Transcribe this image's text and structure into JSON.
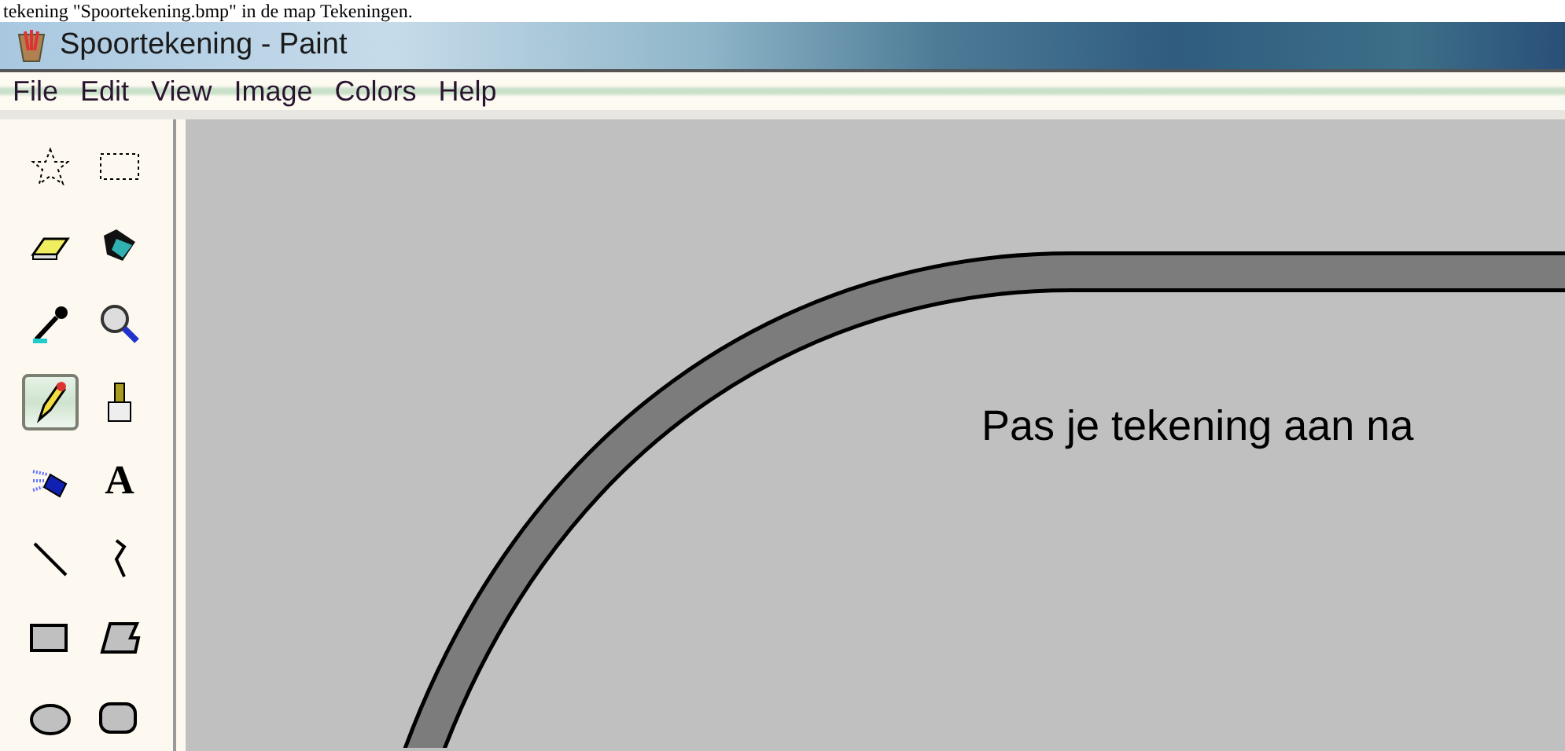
{
  "document_line": "tekening \"Spoortekening.bmp\" in de map Tekeningen.",
  "window": {
    "title": "Spoortekening - Paint"
  },
  "menu": [
    "File",
    "Edit",
    "View",
    "Image",
    "Colors",
    "Help"
  ],
  "tools": [
    {
      "kind": "free-select",
      "selected": false
    },
    {
      "kind": "select",
      "selected": false
    },
    {
      "kind": "eraser",
      "selected": false
    },
    {
      "kind": "fill",
      "selected": false
    },
    {
      "kind": "picker",
      "selected": false
    },
    {
      "kind": "magnifier",
      "selected": false
    },
    {
      "kind": "pencil",
      "selected": true
    },
    {
      "kind": "brush",
      "selected": false
    },
    {
      "kind": "airbrush",
      "selected": false
    },
    {
      "kind": "text",
      "label": "A",
      "selected": false
    },
    {
      "kind": "line",
      "selected": false
    },
    {
      "kind": "curve",
      "selected": false
    },
    {
      "kind": "rectangle",
      "selected": false
    },
    {
      "kind": "polygon",
      "selected": false
    },
    {
      "kind": "ellipse",
      "selected": false
    },
    {
      "kind": "rounded-rectangle",
      "selected": false
    }
  ],
  "canvas": {
    "text": "Pas je tekening aan na"
  }
}
